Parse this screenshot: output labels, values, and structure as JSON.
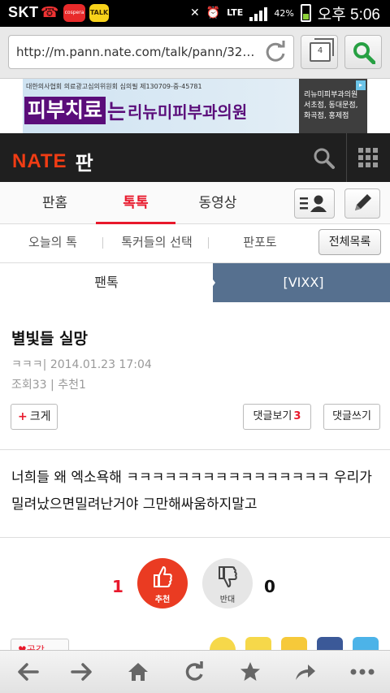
{
  "status_bar": {
    "carrier": "SKT",
    "battery_percent": "42%",
    "time": "오후 5:06",
    "network": "LTE",
    "app_badge_1": "cospera",
    "app_badge_2": "TALK"
  },
  "browser": {
    "url": "http://m.pann.nate.com/talk/pann/3208...",
    "tab_count": "4"
  },
  "ad": {
    "license_text": "대한의사협회 의료광고심의위원회 심의필 제130709-중-45781",
    "headline_part1": "피부치료",
    "headline_part2": "는",
    "clinic_name": "리뉴미피부과의원",
    "side_text": "리뉴미피부과의원 서초점, 동대문점, 화곡점, 홍제점"
  },
  "header": {
    "logo_brand": "NATE",
    "logo_section": "판"
  },
  "main_nav": {
    "tabs": [
      {
        "label": "판홈"
      },
      {
        "label": "톡톡"
      },
      {
        "label": "동영상"
      }
    ],
    "active_tab": "톡톡"
  },
  "sub_nav": {
    "items": [
      {
        "label": "오늘의 톡"
      },
      {
        "label": "톡커들의 선택"
      },
      {
        "label": "판포토"
      }
    ],
    "full_list_label": "전체목록"
  },
  "breadcrumb": {
    "parent": "팬톡",
    "current": "[VIXX]"
  },
  "article": {
    "title": "별빛들 실망",
    "author": "ㅋㅋㅋ",
    "date": "2014.01.23 17:04",
    "views_label": "조회",
    "views": "33",
    "recommend_label": "추천",
    "recommend": "1",
    "font_button": "크게",
    "view_comments_label": "댓글보기",
    "comment_count": "3",
    "write_comment_label": "댓글쓰기",
    "body": "너희들 왜 엑소욕해 ㅋㅋㅋㅋㅋㅋㅋㅋㅋㅋㅋㅋㅋㅋㅋㅋ 우리가 밀려났으면밀려난거야 그만해싸움하지말고"
  },
  "votes": {
    "like_count": "1",
    "like_label": "추천",
    "dislike_label": "반대",
    "dislike_count": "0"
  },
  "share": {
    "empathy_label": "공감"
  },
  "colors": {
    "accent_red": "#e8192c",
    "header_dark": "#1f1f1f",
    "breadcrumb_blue": "#56708f",
    "like_orange": "#ea3b22"
  },
  "icons": {
    "reload": "reload-icon",
    "tabs": "tabs-icon",
    "search": "search-icon",
    "grid": "grid-menu-icon",
    "profile": "profile-list-icon",
    "write": "pencil-icon",
    "thumbs_up": "thumbs-up-icon",
    "thumbs_down": "thumbs-down-icon",
    "back": "back-arrow-icon",
    "forward": "forward-arrow-icon",
    "home": "home-icon",
    "refresh": "refresh-icon",
    "bookmark": "star-icon",
    "share": "share-icon",
    "more": "more-icon"
  }
}
